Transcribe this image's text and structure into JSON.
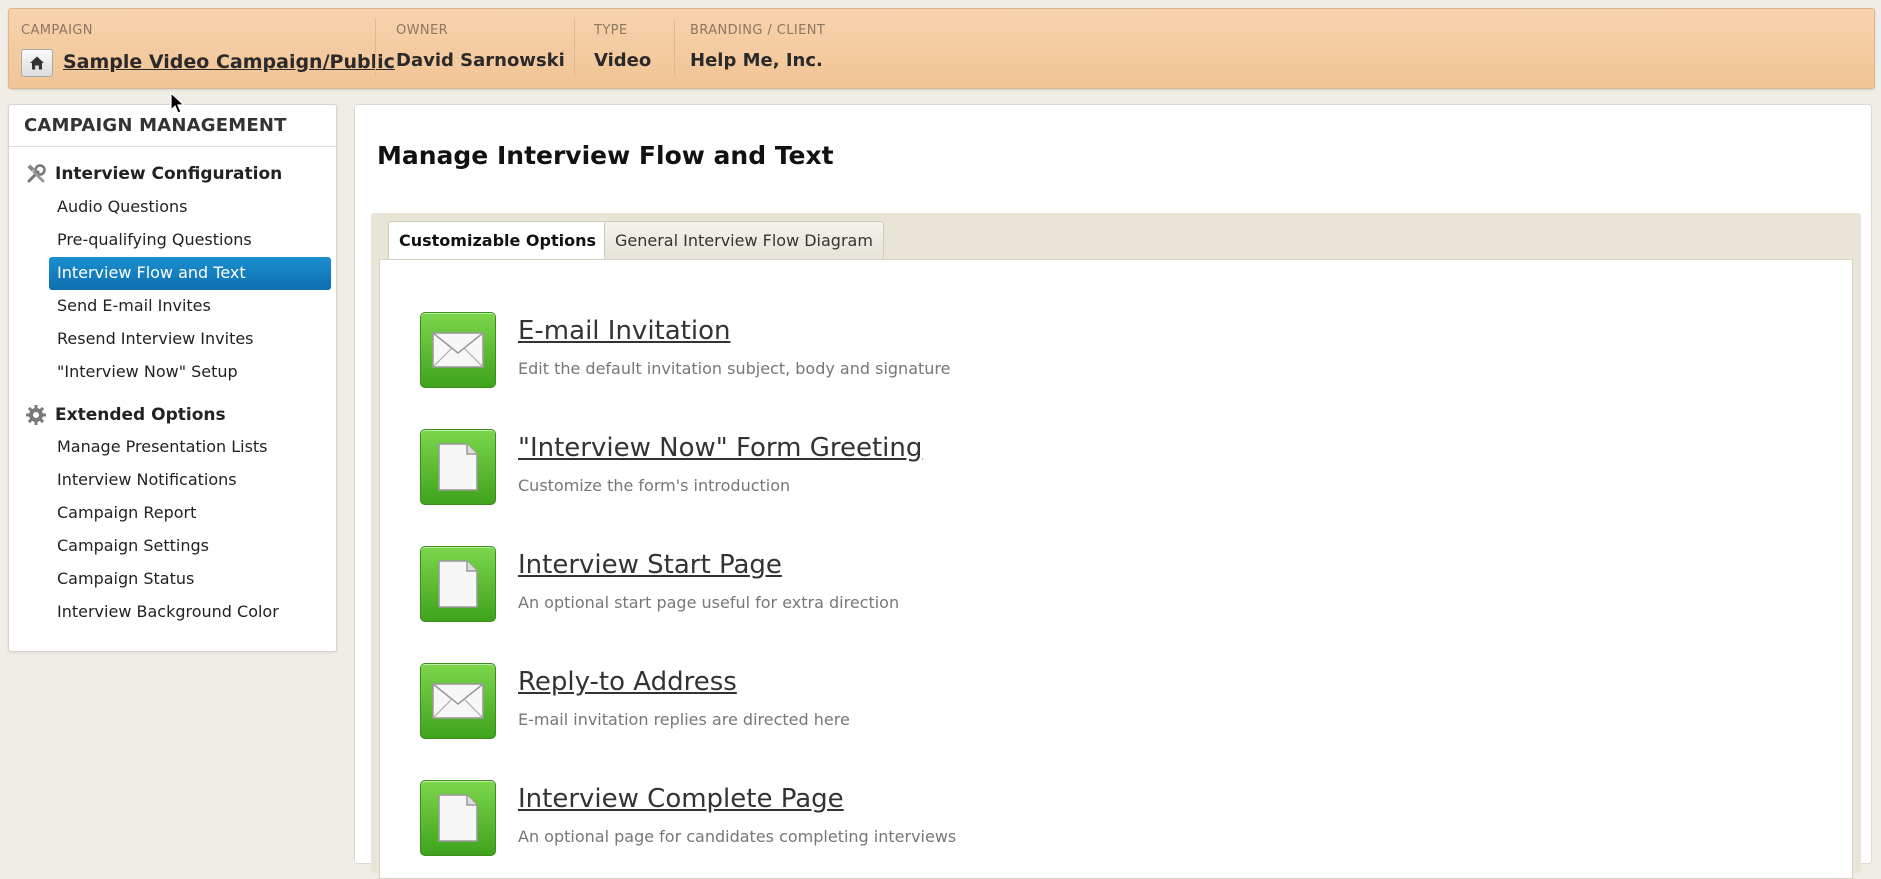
{
  "header": {
    "campaign_caption": "CAMPAIGN",
    "campaign_name": "Sample Video Campaign/Public",
    "owner_caption": "OWNER",
    "owner_value": "David Sarnowski",
    "type_caption": "TYPE",
    "type_value": "Video",
    "branding_caption": "BRANDING / CLIENT",
    "branding_value": "Help Me, Inc."
  },
  "sidebar": {
    "title": "CAMPAIGN MANAGEMENT",
    "group1": {
      "label": "Interview Configuration",
      "icon": "tools-icon",
      "items": [
        {
          "label": "Audio Questions"
        },
        {
          "label": "Pre-qualifying Questions"
        },
        {
          "label": "Interview Flow and Text",
          "active": true
        },
        {
          "label": "Send E-mail Invites"
        },
        {
          "label": "Resend Interview Invites"
        },
        {
          "label": "\"Interview Now\" Setup"
        }
      ]
    },
    "group2": {
      "label": "Extended Options",
      "icon": "gear-icon",
      "items": [
        {
          "label": "Manage Presentation Lists"
        },
        {
          "label": "Interview Notifications"
        },
        {
          "label": "Campaign Report"
        },
        {
          "label": "Campaign Settings"
        },
        {
          "label": "Campaign Status"
        },
        {
          "label": "Interview Background Color"
        }
      ]
    }
  },
  "main": {
    "title": "Manage Interview Flow and Text",
    "tabs": [
      {
        "label": "Customizable Options",
        "active": true
      },
      {
        "label": "General Interview Flow Diagram"
      }
    ],
    "options": [
      {
        "title": "E-mail Invitation",
        "desc": "Edit the default invitation subject, body and signature",
        "icon": "envelope-icon"
      },
      {
        "title": "\"Interview Now\" Form Greeting",
        "desc": "Customize the form's introduction",
        "icon": "document-icon"
      },
      {
        "title": "Interview Start Page",
        "desc": "An optional start page useful for extra direction",
        "icon": "document-icon"
      },
      {
        "title": "Reply-to Address",
        "desc": "E-mail invitation replies are directed here",
        "icon": "envelope-icon"
      },
      {
        "title": "Interview Complete Page",
        "desc": "An optional page for candidates completing interviews",
        "icon": "document-icon"
      }
    ]
  },
  "colors": {
    "header_bg": "#f4cca2",
    "active_nav": "#1580c0",
    "icon_green": "#5cbf32"
  }
}
